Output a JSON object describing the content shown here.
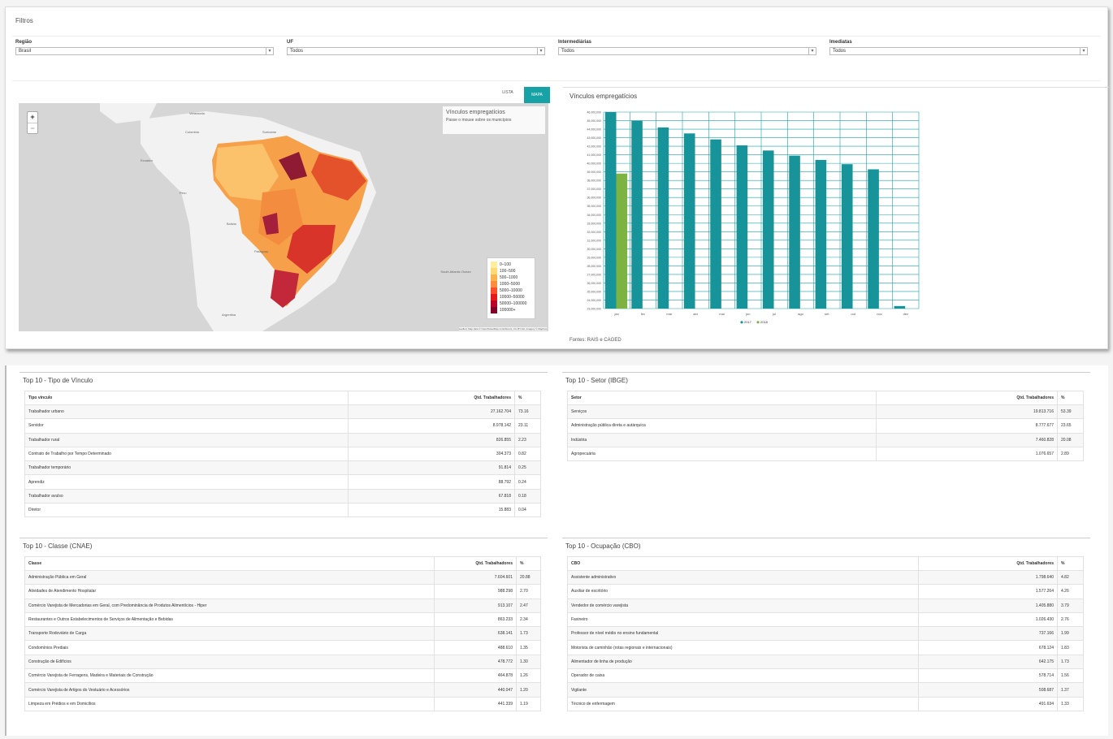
{
  "filters": {
    "title": "Filtros",
    "items": [
      {
        "label": "Região",
        "value": "Brasil"
      },
      {
        "label": "UF",
        "value": "Todos"
      },
      {
        "label": "Intermediárias",
        "value": "Todos"
      },
      {
        "label": "Imediatas",
        "value": "Todos"
      }
    ]
  },
  "map": {
    "tab_list": "LISTA",
    "tab_map": "MAPA",
    "zoom_in": "+",
    "zoom_out": "−",
    "info_title": "Vínculos empregatícios",
    "info_subtitle": "Passe o mouse sobre os municípios",
    "attribution": "Leaflet | Map data © OpenStreetMap contributors, CC-BY-SA, Imagery © Mapbox",
    "places": [
      "Venezuela",
      "Colombia",
      "Suriname",
      "Ecuador",
      "Peru",
      "Bolivia",
      "Paraguay",
      "Argentina",
      "South Atlantic Ocean"
    ],
    "legend": [
      {
        "label": "0–100",
        "color": "#ffeda0"
      },
      {
        "label": "100–500",
        "color": "#fed976"
      },
      {
        "label": "500–1000",
        "color": "#feb24c"
      },
      {
        "label": "1000–5000",
        "color": "#fd8d3c"
      },
      {
        "label": "5000–10000",
        "color": "#fc4e2a"
      },
      {
        "label": "10000–50000",
        "color": "#e31a1c"
      },
      {
        "label": "50000–100000",
        "color": "#bd0026"
      },
      {
        "label": "100000+",
        "color": "#800026"
      }
    ]
  },
  "chart": {
    "title": "Vínculos empregatícios",
    "footnote": "Fontes: RAIS e CAGED"
  },
  "chart_data": {
    "type": "bar",
    "categories": [
      "jan",
      "fev",
      "mar",
      "abr",
      "mai",
      "jun",
      "jul",
      "ago",
      "set",
      "out",
      "nov",
      "dez"
    ],
    "series": [
      {
        "name": "2017",
        "color": "#17939a",
        "values": [
          46000000,
          45000000,
          44200000,
          43500000,
          42800000,
          42100000,
          41500000,
          40900000,
          40400000,
          39900000,
          39300000,
          23300000
        ]
      },
      {
        "name": "2018",
        "color": "#7cb342",
        "values": [
          38800000,
          null,
          null,
          null,
          null,
          null,
          null,
          null,
          null,
          null,
          null,
          null
        ]
      }
    ],
    "ylim": [
      23000000,
      46000000
    ],
    "yticks": [
      "46,000,000",
      "45,000,000",
      "44,000,000",
      "43,000,000",
      "42,000,000",
      "41,000,000",
      "40,000,000",
      "39,000,000",
      "38,000,000",
      "37,000,000",
      "36,000,000",
      "35,000,000",
      "34,000,000",
      "33,000,000",
      "32,000,000",
      "31,000,000",
      "30,000,000",
      "29,000,000",
      "28,000,000",
      "27,000,000",
      "26,000,000",
      "25,000,000",
      "24,000,000",
      "23,000,000"
    ],
    "legend_position": "bottom",
    "grid": true
  },
  "tables": {
    "tipo_vinculo": {
      "title": "Top 10 - Tipo de Vínculo",
      "headers": [
        "Tipo vínculo",
        "Qtd. Trabalhadores",
        "%"
      ],
      "rows": [
        [
          "Trabalhador urbano",
          "27.162.704",
          "73.16"
        ],
        [
          "Servidor",
          "8.978.142",
          "23.11"
        ],
        [
          "Trabalhador rural",
          "826.855",
          "2.23"
        ],
        [
          "Contrato de Trabalho por Tempo Determinado",
          "304.373",
          "0.82"
        ],
        [
          "Trabalhador temporário",
          "91.814",
          "0.25"
        ],
        [
          "Aprendiz",
          "88.792",
          "0.24"
        ],
        [
          "Trabalhador avulso",
          "67.818",
          "0.18"
        ],
        [
          "Diretor",
          "15.883",
          "0.04"
        ]
      ]
    },
    "setor": {
      "title": "Top 10 - Setor (IBGE)",
      "headers": [
        "Setor",
        "Qtd. Trabalhadores",
        "%"
      ],
      "rows": [
        [
          "Serviços",
          "19.813.716",
          "53.39"
        ],
        [
          "Administração pública direta e autárquica",
          "8.777.677",
          "23.65"
        ],
        [
          "Indústria",
          "7.460.828",
          "20.08"
        ],
        [
          "Agropecuária",
          "1.076.657",
          "2.89"
        ]
      ]
    },
    "classe": {
      "title": "Top 10 - Classe (CNAE)",
      "headers": [
        "Classe",
        "Qtd. Trabalhadores",
        "%"
      ],
      "rows": [
        [
          "Administração Pública em Geral",
          "7.604.601",
          "20.88"
        ],
        [
          "Atividades de Atendimento Hospitalar",
          "988.298",
          "2.70"
        ],
        [
          "Comércio Varejista de Mercadorias em Geral, com Predominância de Produtos Alimentícios - Hiper",
          "913.107",
          "2.47"
        ],
        [
          "Restaurantes e Outros Estabelecimentos de Serviços de Alimentação e Bebidas",
          "863.233",
          "2.34"
        ],
        [
          "Transporte Rodoviário de Carga",
          "638.141",
          "1.73"
        ],
        [
          "Condomínios Prediais",
          "488.610",
          "1.35"
        ],
        [
          "Construção de Edifícios",
          "478.772",
          "1.30"
        ],
        [
          "Comércio Varejista de Ferragens, Madeira e Materiais de Construção",
          "464.878",
          "1.26"
        ],
        [
          "Comércio Varejista de Artigos do Vestuário e Acessórios",
          "440.047",
          "1.20"
        ],
        [
          "Limpeza em Prédios e em Domicílios",
          "441.339",
          "1.19"
        ]
      ]
    },
    "ocupacao": {
      "title": "Top 10 - Ocupação (CBO)",
      "headers": [
        "CBO",
        "Qtd. Trabalhadores",
        "%"
      ],
      "rows": [
        [
          "Assistente administrativo",
          "1.798.640",
          "4.82"
        ],
        [
          "Auxiliar de escritório",
          "1.577.264",
          "4.26"
        ],
        [
          "Vendedor de comércio varejista",
          "1.405.880",
          "3.79"
        ],
        [
          "Faxineiro",
          "1.026.430",
          "2.76"
        ],
        [
          "Professor de nível médio no ensino fundamental",
          "737.166",
          "1.99"
        ],
        [
          "Motorista de caminhão (rotas regionais e internacionais)",
          "678.124",
          "1.83"
        ],
        [
          "Alimentador de linha de produção",
          "642.175",
          "1.73"
        ],
        [
          "Operador de caixa",
          "578.714",
          "1.56"
        ],
        [
          "Vigilante",
          "508.687",
          "1.37"
        ],
        [
          "Técnico de enfermagem",
          "491.634",
          "1.33"
        ]
      ]
    }
  }
}
